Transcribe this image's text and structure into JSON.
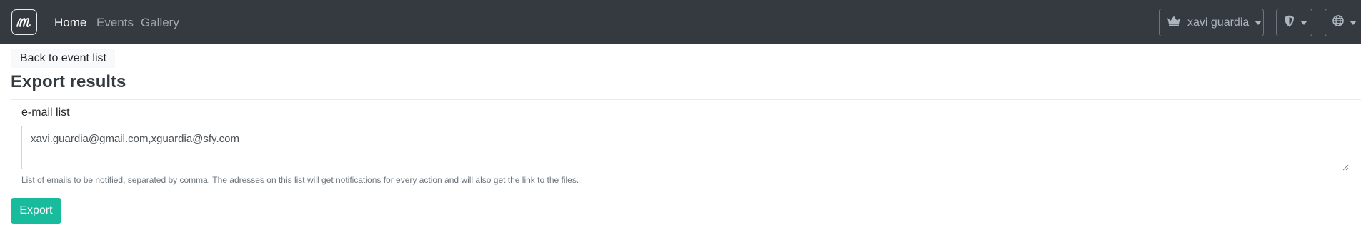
{
  "navbar": {
    "brand_icon": "logo-m-icon",
    "links": [
      {
        "label": "Home",
        "active": true
      },
      {
        "label": "Events",
        "active": false
      },
      {
        "label": "Gallery",
        "active": false
      }
    ],
    "user_menu": {
      "icon": "crown-icon",
      "label": "xavi guardia"
    },
    "admin_menu": {
      "icon": "shield-icon"
    },
    "language_menu": {
      "icon": "globe-icon"
    }
  },
  "back_link": "Back to event list",
  "page_title": "Export results",
  "form": {
    "email_label": "e-mail list",
    "email_value": "xavi.guardia@gmail.com,xguardia@sfy.com",
    "help_text": "List of emails to be notified, separated by comma. The adresses on this list will get notifications for every action and will also get the link to the files.",
    "submit_label": "Export"
  },
  "colors": {
    "navbar_bg": "#343a40",
    "primary_button": "#18bc9c",
    "help_text": "#6c757d"
  }
}
